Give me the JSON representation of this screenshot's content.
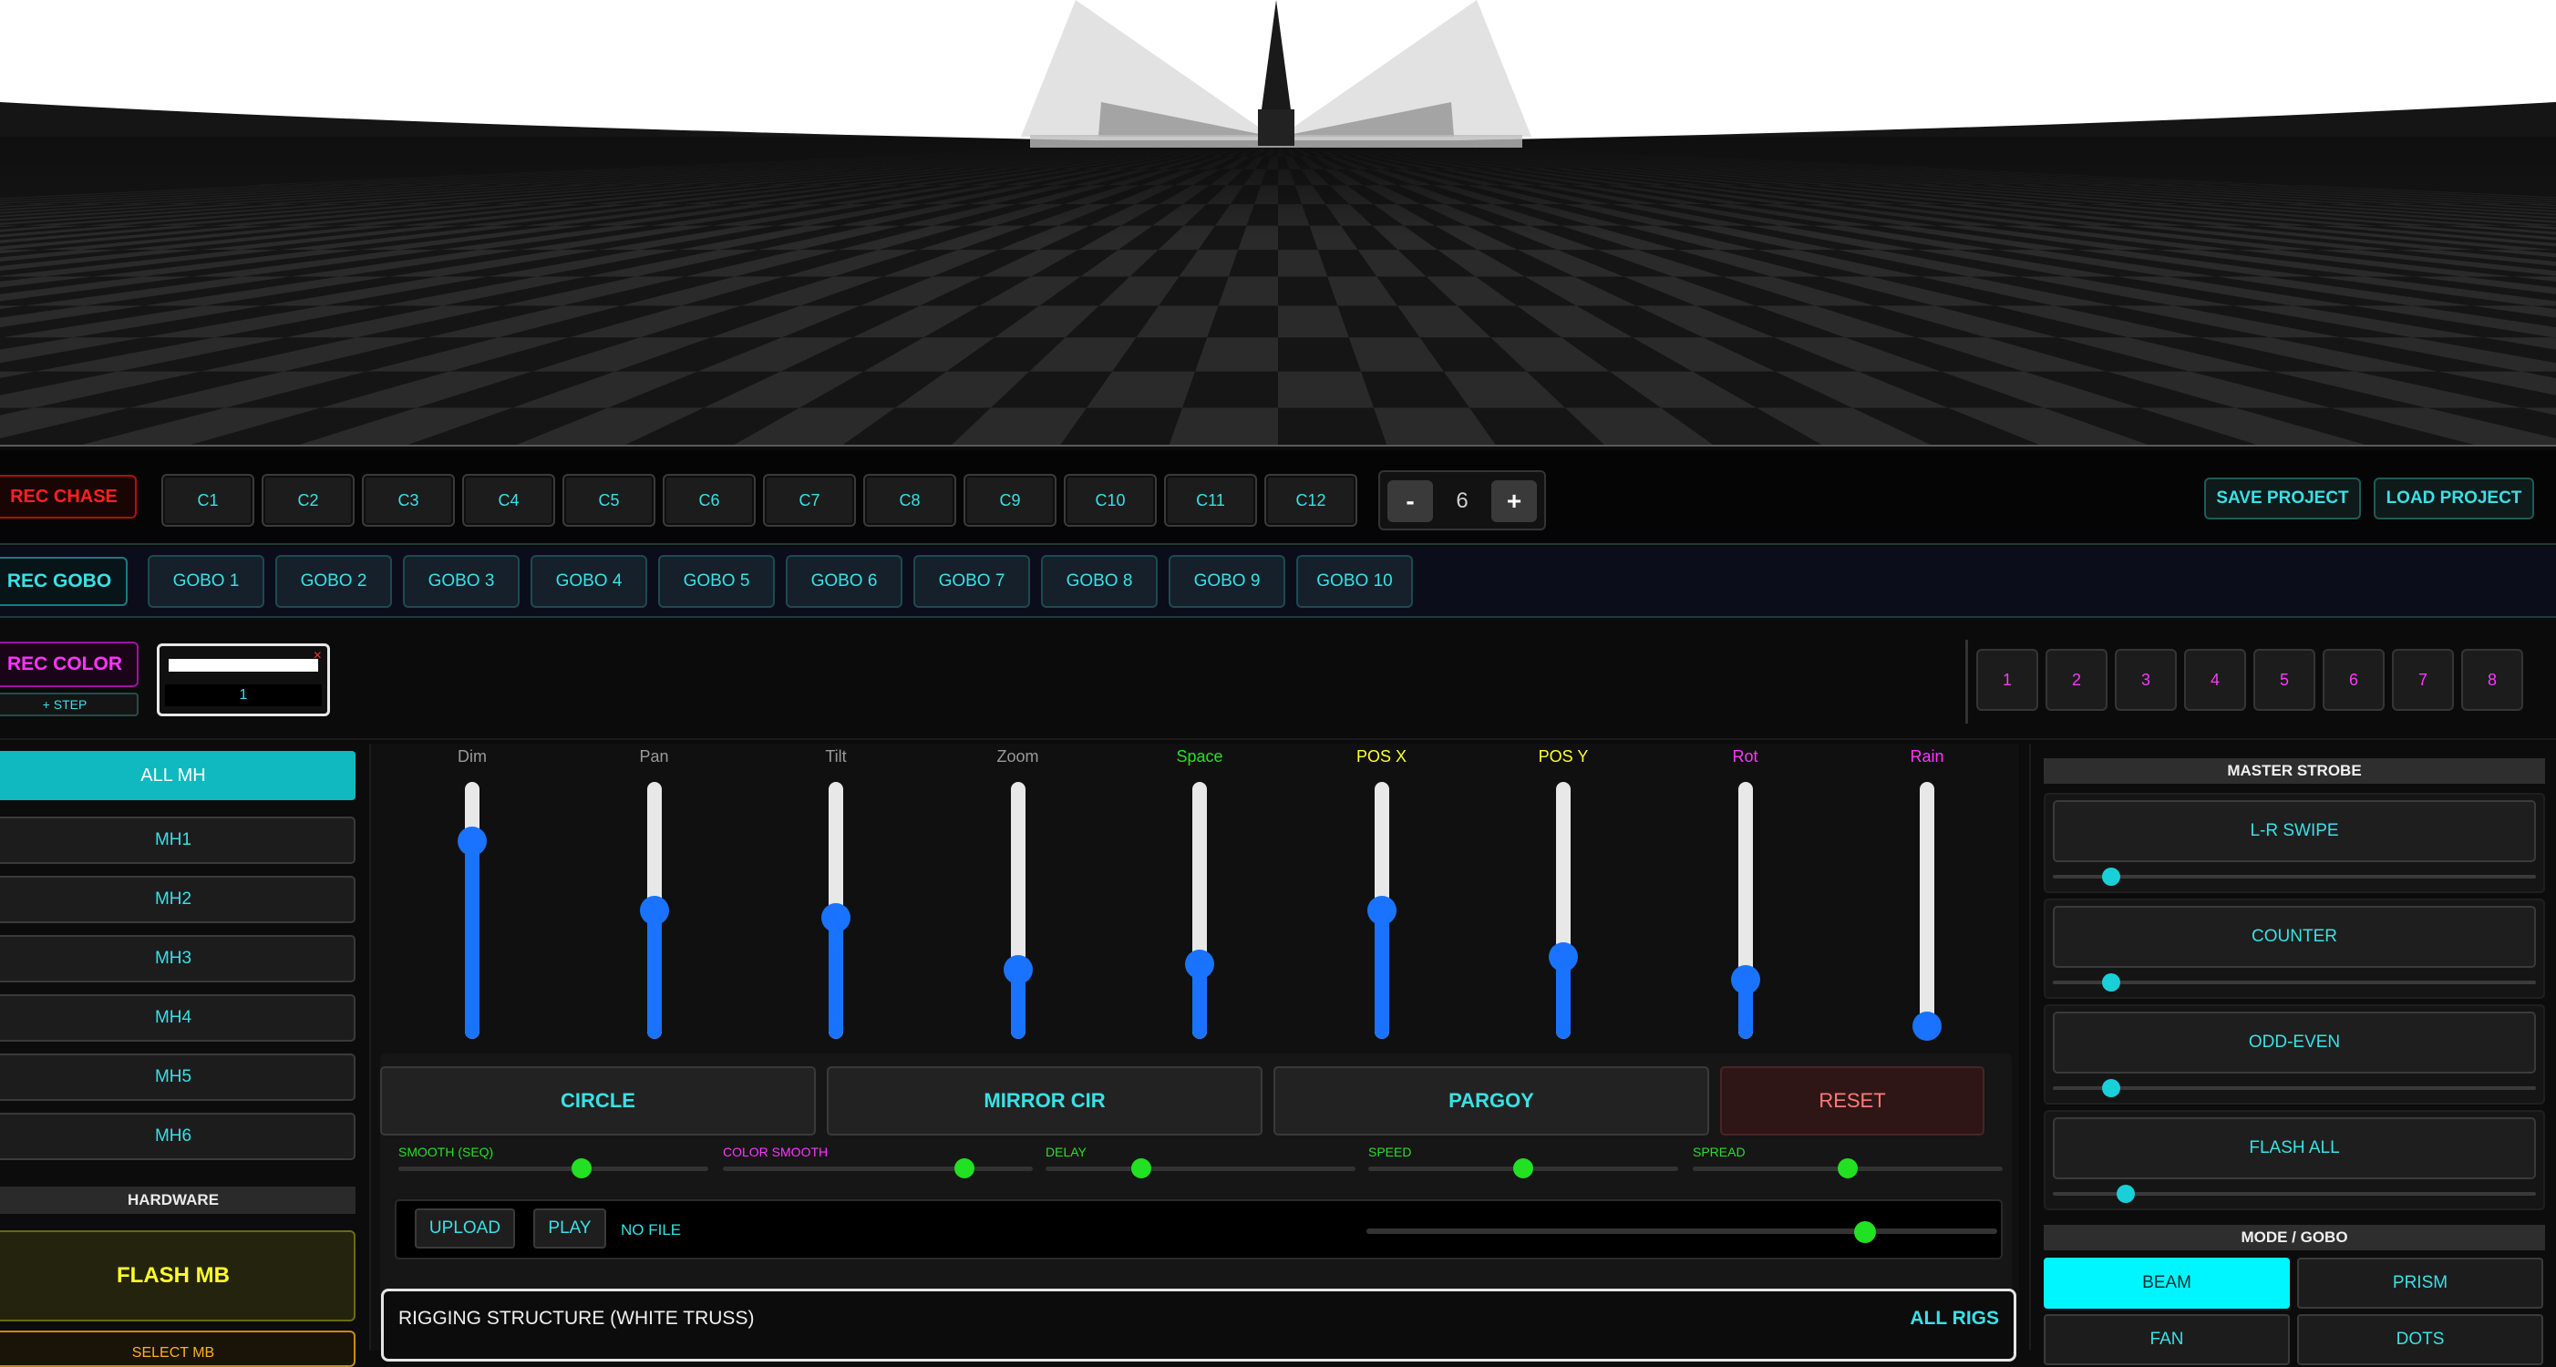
{
  "chase": {
    "rec_label": "REC CHASE",
    "slots": [
      "C1",
      "C2",
      "C3",
      "C4",
      "C5",
      "C6",
      "C7",
      "C8",
      "C9",
      "C10",
      "C11",
      "C12"
    ],
    "minus_label": "-",
    "step_value": "6",
    "plus_label": "+",
    "save_label": "SAVE PROJECT",
    "load_label": "LOAD PROJECT"
  },
  "gobo": {
    "rec_label": "REC GOBO",
    "slots": [
      "GOBO 1",
      "GOBO 2",
      "GOBO 3",
      "GOBO 4",
      "GOBO 5",
      "GOBO 6",
      "GOBO 7",
      "GOBO 8",
      "GOBO 9",
      "GOBO 10"
    ]
  },
  "color": {
    "rec_label": "REC COLOR",
    "add_step_label": "+ STEP",
    "slot_close": "×",
    "slot_number": "1",
    "slot_color": "#ffffff",
    "numbers": [
      "1",
      "2",
      "3",
      "4",
      "5",
      "6",
      "7",
      "8"
    ]
  },
  "heads": {
    "all_label": "ALL MH",
    "items": [
      "MH1",
      "MH2",
      "MH3",
      "MH4",
      "MH5",
      "MH6"
    ],
    "hardware_label": "HARDWARE",
    "flash_label": "FLASH MB",
    "select_label": "SELECT MB"
  },
  "faders": [
    {
      "label": "Dim",
      "color": "#9a9a9a",
      "level": 0.77
    },
    {
      "label": "Pan",
      "color": "#9a9a9a",
      "level": 0.5
    },
    {
      "label": "Tilt",
      "color": "#9a9a9a",
      "level": 0.47
    },
    {
      "label": "Zoom",
      "color": "#9a9a9a",
      "level": 0.27
    },
    {
      "label": "Space",
      "color": "#27e027",
      "level": 0.29
    },
    {
      "label": "POS X",
      "color": "#ffff30",
      "level": 0.5
    },
    {
      "label": "POS Y",
      "color": "#ffff30",
      "level": 0.32
    },
    {
      "label": "Rot",
      "color": "#ff35ff",
      "level": 0.23
    },
    {
      "label": "Rain",
      "color": "#ff35ff",
      "level": 0.05
    }
  ],
  "patterns": {
    "circle_label": "CIRCLE",
    "mirror_label": "MIRROR CIR",
    "pargoy_label": "PARGOY",
    "reset_label": "RESET"
  },
  "sliders": [
    {
      "label": "SMOOTH (SEQ)",
      "color": "#27e027",
      "level": 0.59
    },
    {
      "label": "COLOR SMOOTH",
      "color": "#ff35ff",
      "level": 0.78
    },
    {
      "label": "DELAY",
      "color": "#27e027",
      "level": 0.31
    },
    {
      "label": "SPEED",
      "color": "#27e027",
      "level": 0.5
    },
    {
      "label": "SPREAD",
      "color": "#27e027",
      "level": 0.5
    }
  ],
  "player": {
    "upload_label": "UPLOAD",
    "play_label": "PLAY",
    "file_label": "NO FILE",
    "waveform": "___________________________________",
    "position": 0.79
  },
  "rigging": {
    "title": "RIGGING STRUCTURE (WHITE TRUSS)",
    "all_label": "ALL RIGS"
  },
  "strobe": {
    "title": "MASTER STROBE",
    "items": [
      {
        "label": "L-R SWIPE",
        "level": 0.12
      },
      {
        "label": "COUNTER",
        "level": 0.12
      },
      {
        "label": "ODD-EVEN",
        "level": 0.12
      },
      {
        "label": "FLASH ALL",
        "level": 0.15
      }
    ]
  },
  "mode": {
    "title": "MODE / GOBO",
    "items": [
      "BEAM",
      "PRISM",
      "FAN",
      "DOTS"
    ],
    "active": "BEAM"
  },
  "colors": {
    "accent": "#39e1e6",
    "fader_fill": "#1a73ff",
    "slider_knob": "#22e022",
    "active_mode": "#00f6ff"
  }
}
